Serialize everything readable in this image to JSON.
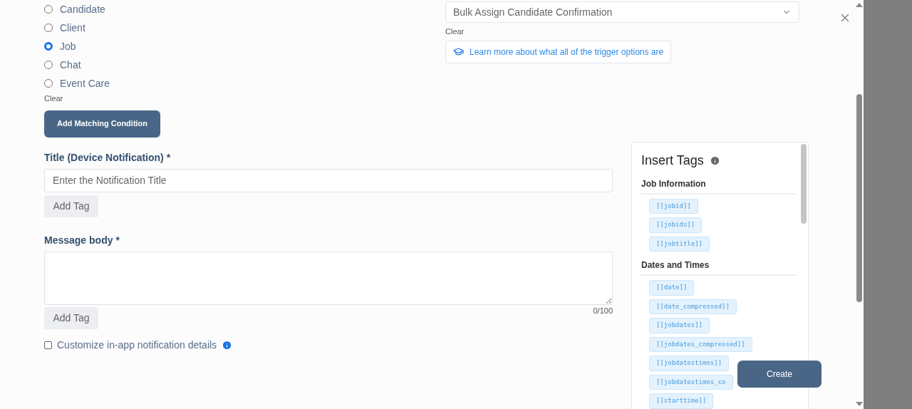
{
  "recipient_type": {
    "options": [
      {
        "label": "Candidate",
        "selected": false
      },
      {
        "label": "Client",
        "selected": false
      },
      {
        "label": "Job",
        "selected": true
      },
      {
        "label": "Chat",
        "selected": false
      },
      {
        "label": "Event Care",
        "selected": false
      }
    ],
    "clear": "Clear",
    "add_button": "Add Matching Condition"
  },
  "trigger": {
    "value": "Bulk Assign Candidate Confirmation",
    "clear": "Clear",
    "learn_more": "Learn more about what all of the trigger options are"
  },
  "title_field": {
    "label": "Title (Device Notification)",
    "required": "*",
    "placeholder": "Enter the Notification Title",
    "add_tag": "Add Tag"
  },
  "message_field": {
    "label": "Message body",
    "required": "*",
    "counter": "0/100",
    "add_tag": "Add Tag"
  },
  "customize": {
    "label": "Customize in-app notification details",
    "checked": false
  },
  "insert_tags": {
    "title": "Insert Tags",
    "groups": [
      {
        "heading": "Job Information",
        "tags": [
          "[[jobid]]",
          "[[jobids]]",
          "[[jobtitle]]"
        ]
      },
      {
        "heading": "Dates and Times",
        "tags": [
          "[[date]]",
          "[[date_compressed]]",
          "[[jobdates]]",
          "[[jobdates_compressed]]",
          "[[jobdatestimes]]",
          "[[jobdatestimes_co",
          "[[starttime]]"
        ]
      }
    ]
  },
  "create_button": "Create"
}
